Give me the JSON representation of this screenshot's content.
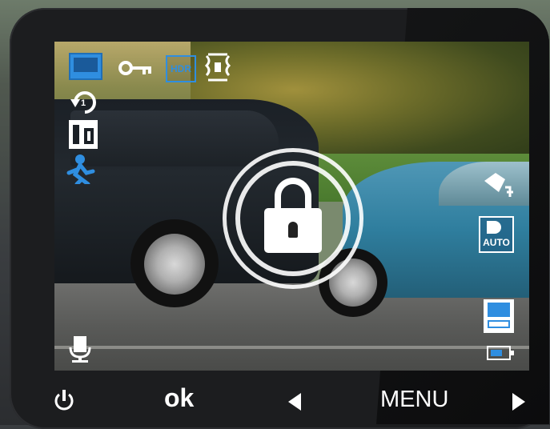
{
  "screen": {
    "hud": {
      "hdr_label": "HDR",
      "auto_label": "AUTO"
    }
  },
  "softkeys": {
    "ok_label": "ok",
    "menu_label": "MENU"
  },
  "colors": {
    "hud_blue": "#2f8ee0",
    "device_body": "#1c1d1f"
  },
  "icons": [
    "camera-mode-icon",
    "key-icon",
    "hdr-icon",
    "parking-mode-icon",
    "loop-record-icon",
    "g-sensor-icon",
    "motion-detect-icon",
    "emergency-lock-icon",
    "collision-icon",
    "light-auto-icon",
    "sd-card-icon",
    "battery-icon",
    "mic-off-icon",
    "power-icon",
    "left-arrow-icon",
    "right-arrow-icon"
  ]
}
